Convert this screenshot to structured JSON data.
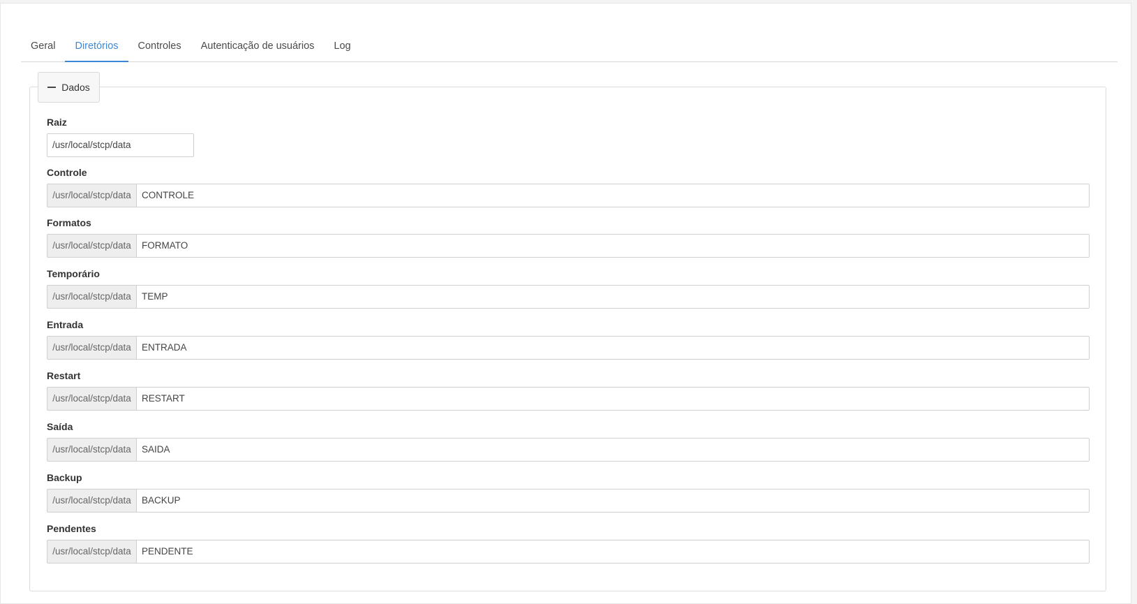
{
  "tabs": [
    {
      "label": "Geral",
      "active": false
    },
    {
      "label": "Diretórios",
      "active": true
    },
    {
      "label": "Controles",
      "active": false
    },
    {
      "label": "Autenticação de usuários",
      "active": false
    },
    {
      "label": "Log",
      "active": false
    }
  ],
  "section": {
    "toggle_icon": "minus-icon",
    "title": "Dados"
  },
  "root_field": {
    "label": "Raiz",
    "value": "/usr/local/stcp/data"
  },
  "fields": [
    {
      "label": "Controle",
      "prefix": "/usr/local/stcp/data",
      "value": "CONTROLE"
    },
    {
      "label": "Formatos",
      "prefix": "/usr/local/stcp/data",
      "value": "FORMATO"
    },
    {
      "label": "Temporário",
      "prefix": "/usr/local/stcp/data",
      "value": "TEMP"
    },
    {
      "label": "Entrada",
      "prefix": "/usr/local/stcp/data",
      "value": "ENTRADA"
    },
    {
      "label": "Restart",
      "prefix": "/usr/local/stcp/data",
      "value": "RESTART"
    },
    {
      "label": "Saída",
      "prefix": "/usr/local/stcp/data",
      "value": "SAIDA"
    },
    {
      "label": "Backup",
      "prefix": "/usr/local/stcp/data",
      "value": "BACKUP"
    },
    {
      "label": "Pendentes",
      "prefix": "/usr/local/stcp/data",
      "value": "PENDENTE"
    }
  ],
  "colors": {
    "accent": "#3c88d8",
    "addon_bg": "#eeeeee",
    "border": "#cfcfcf"
  }
}
